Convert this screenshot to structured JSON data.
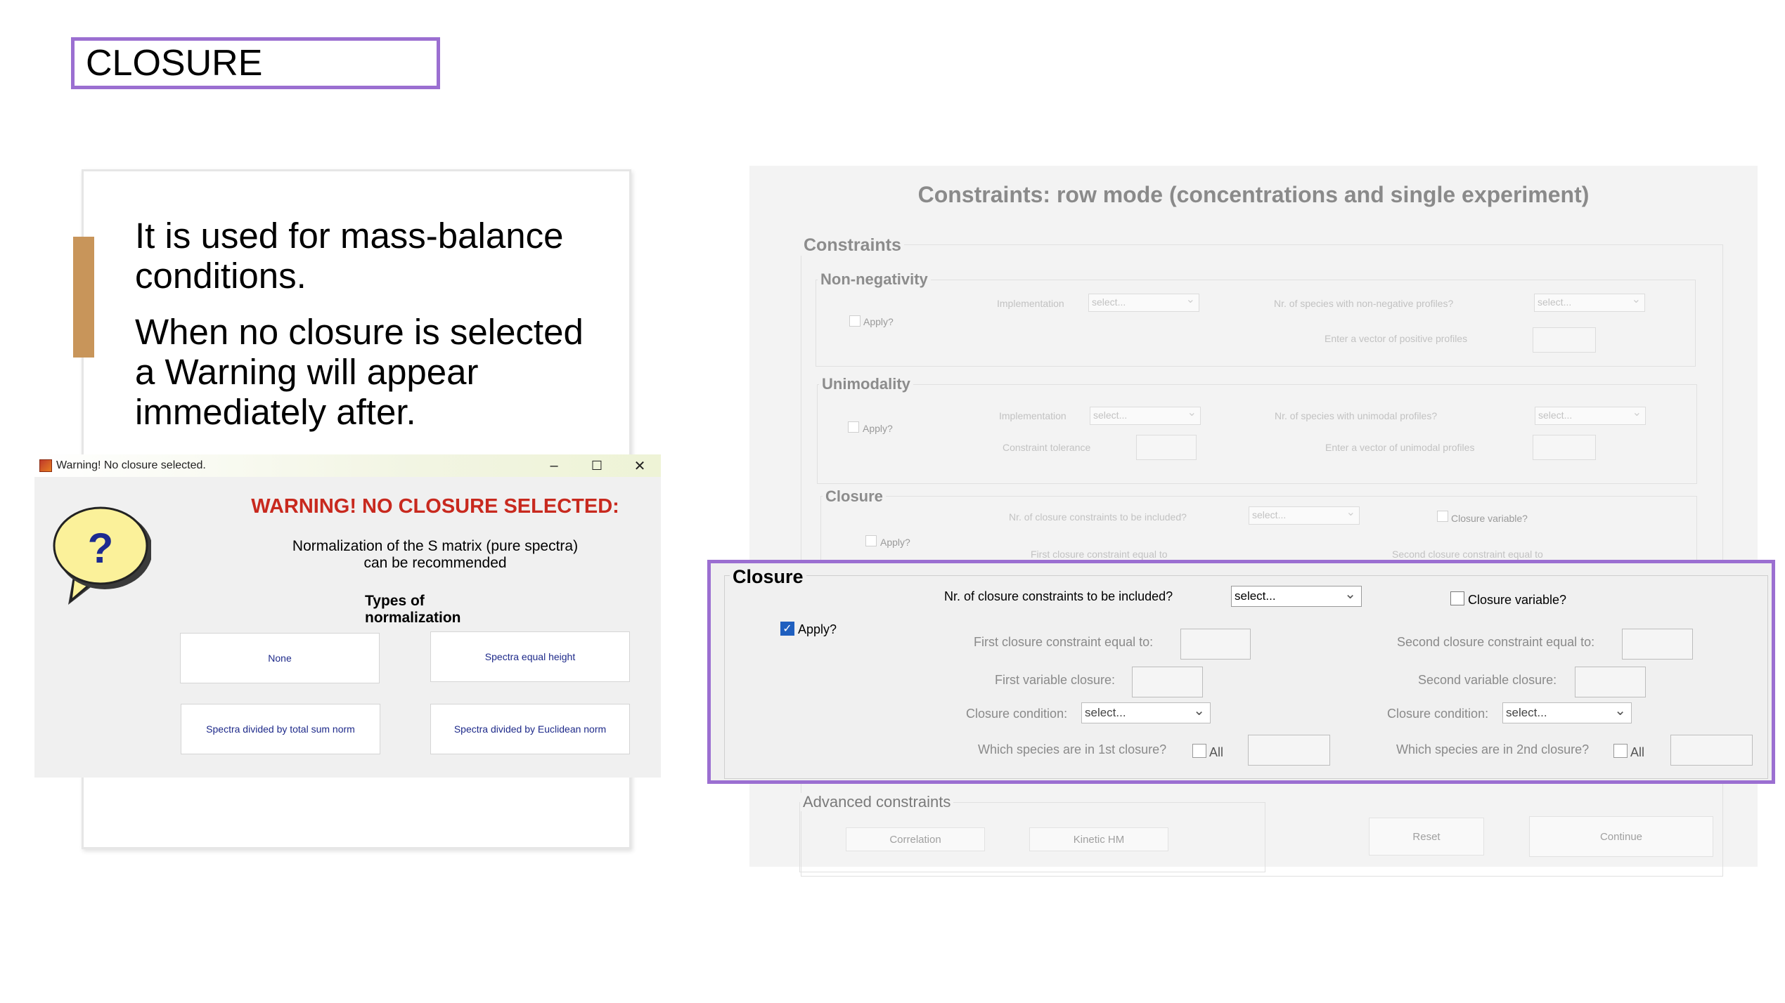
{
  "slide": {
    "title": "CLOSURE",
    "bullets": [
      "It is used for mass-balance conditions.",
      "When no closure is selected a Warning will appear immediately after."
    ]
  },
  "warning_dialog": {
    "window_title": "Warning! No closure selected.",
    "controls": {
      "minimize": "–",
      "maximize": "☐",
      "close": "✕"
    },
    "heading": "WARNING! NO CLOSURE SELECTED:",
    "message_line1": "Normalization of the S matrix (pure spectra)",
    "message_line2": "can be recommended",
    "types_label": "Types of normalization",
    "bubble_glyph": "?",
    "icon": "question-bubble-icon",
    "buttons": [
      "None",
      "Spectra equal height",
      "Spectra divided by total sum norm",
      "Spectra divided by Euclidean norm"
    ]
  },
  "constraints_panel": {
    "title": "Constraints: row mode (concentrations and single experiment)",
    "group_label": "Constraints",
    "nonnegativity": {
      "label": "Non-negativity",
      "implementation_label": "Implementation",
      "implementation_value": "select...",
      "species_label": "Nr. of species with non-negative profiles?",
      "species_value": "select...",
      "vector_label": "Enter a vector of positive profiles",
      "apply_label": "Apply?"
    },
    "unimodality": {
      "label": "Unimodality",
      "implementation_label": "Implementation",
      "implementation_value": "select...",
      "species_label": "Nr. of species with unimodal profiles?",
      "species_value": "select...",
      "tolerance_label": "Constraint tolerance",
      "vector_label": "Enter a vector of unimodal profiles",
      "apply_label": "Apply?"
    },
    "closure_faded": {
      "label": "Closure",
      "nr_label": "Nr. of closure constraints to be included?",
      "nr_value": "select...",
      "variable_label": "Closure variable?",
      "apply_label": "Apply?",
      "first_label": "First closure constraint equal to",
      "second_label": "Second closure constraint equal to"
    },
    "advanced": {
      "label": "Advanced constraints",
      "buttons": [
        "Correlation",
        "Kinetic HM"
      ]
    },
    "reset_label": "Reset",
    "continue_label": "Continue"
  },
  "closure_panel": {
    "label": "Closure",
    "nr_constraints_label": "Nr. of closure constraints to be included?",
    "nr_constraints_value": "select...",
    "closure_variable_label": "Closure variable?",
    "apply_label": "Apply?",
    "apply_checked": true,
    "first_equal_label": "First closure constraint equal to:",
    "second_equal_label": "Second closure constraint equal to:",
    "first_variable_label": "First variable closure:",
    "second_variable_label": "Second variable closure:",
    "condition_label_1": "Closure condition:",
    "condition_value_1": "select...",
    "condition_label_2": "Closure condition:",
    "condition_value_2": "select...",
    "species_1_label": "Which species are in 1st closure?",
    "species_2_label": "Which species are in 2nd closure?",
    "all_label_1": "All",
    "all_label_2": "All",
    "check_glyph": "✓"
  },
  "colors": {
    "highlight_border": "#9b6fd1",
    "accent_bar": "#c8955a",
    "warning_red": "#c8291e",
    "button_text": "#1e2a8a",
    "checkbox_blue": "#1f5fbf"
  }
}
